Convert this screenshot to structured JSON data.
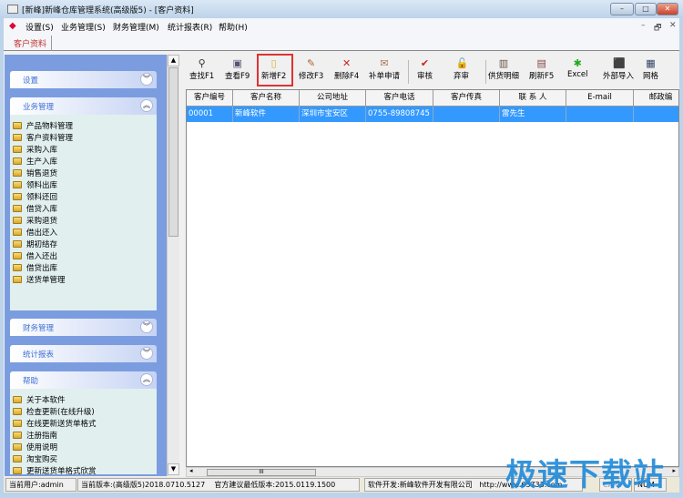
{
  "window": {
    "title": "[新峰]新峰仓库管理系统(高级版5) - [客户资料]",
    "minimize": "–",
    "maximize": "□",
    "close": "✕"
  },
  "menu": [
    "设置(S)",
    "业务管理(S)",
    "财务管理(M)",
    "统计报表(R)",
    "帮助(H)"
  ],
  "mdi_controls": [
    "–",
    "🗗",
    "✕"
  ],
  "tab": "客户资料",
  "sidebar": {
    "sections": [
      {
        "title": "设置",
        "expanded": false,
        "items": []
      },
      {
        "title": "业务管理",
        "expanded": true,
        "items": [
          "产品物料管理",
          "客户资料管理",
          "采购入库",
          "生产入库",
          "销售退货",
          "领料出库",
          "领料还回",
          "借贷入库",
          "采购退货",
          "借出还入",
          "期初结存",
          "借入还出",
          "借贷出库",
          "送货单管理"
        ]
      },
      {
        "title": "财务管理",
        "expanded": false,
        "items": []
      },
      {
        "title": "统计报表",
        "expanded": false,
        "items": []
      },
      {
        "title": "帮助",
        "expanded": true,
        "items": [
          "关于本软件",
          "检查更新(在线升级)",
          "在线更新送货单格式",
          "注册指南",
          "使用说明",
          "淘宝购买",
          "更新送货单格式欣赏"
        ]
      }
    ]
  },
  "toolbar": [
    {
      "label": "查找F1",
      "icon": "binoculars-icon",
      "color": "#333"
    },
    {
      "label": "查看F9",
      "icon": "view-icon",
      "color": "#557"
    },
    {
      "label": "新增F2",
      "icon": "new-document-icon",
      "color": "#d9b030",
      "highlighted": true
    },
    {
      "label": "修改F3",
      "icon": "edit-icon",
      "color": "#a63"
    },
    {
      "label": "删除F4",
      "icon": "delete-icon",
      "color": "#c22"
    },
    {
      "label": "补单申请",
      "icon": "apply-icon",
      "color": "#a75"
    },
    {
      "label": "审核",
      "icon": "check-icon",
      "color": "#c22"
    },
    {
      "label": "弃审",
      "icon": "unlock-icon",
      "color": "#555"
    },
    {
      "label": "供货明细",
      "icon": "detail-icon",
      "color": "#654"
    },
    {
      "label": "刷新F5",
      "icon": "refresh-icon",
      "color": "#844"
    },
    {
      "label": "Excel",
      "icon": "excel-icon",
      "color": "#2a2"
    },
    {
      "label": "外部导入",
      "icon": "import-icon",
      "color": "#369"
    },
    {
      "label": "网格",
      "icon": "grid-icon",
      "color": "#346"
    }
  ],
  "grid": {
    "columns": [
      "客户编号",
      "客户名称",
      "公司地址",
      "客户电话",
      "客户传真",
      "联 系 人",
      "E-mail",
      "邮政编"
    ],
    "rows": [
      [
        "00001",
        "新峰软件",
        "深圳市宝安区",
        "0755-89808745",
        "",
        "雷先生",
        "",
        ""
      ]
    ],
    "selected_color": "#3399ff"
  },
  "status": {
    "user": "当前用户:admin",
    "version": "当前版本:(高级版5)2018.0710.5127",
    "min_version": "官方建议最低版本:2015.0119.1500",
    "developer": "软件开发:新峰软件开发有限公司",
    "url": "http://www.63733.com",
    "caps": "CAPS",
    "num": "NUM"
  },
  "watermark": "极速下载站"
}
